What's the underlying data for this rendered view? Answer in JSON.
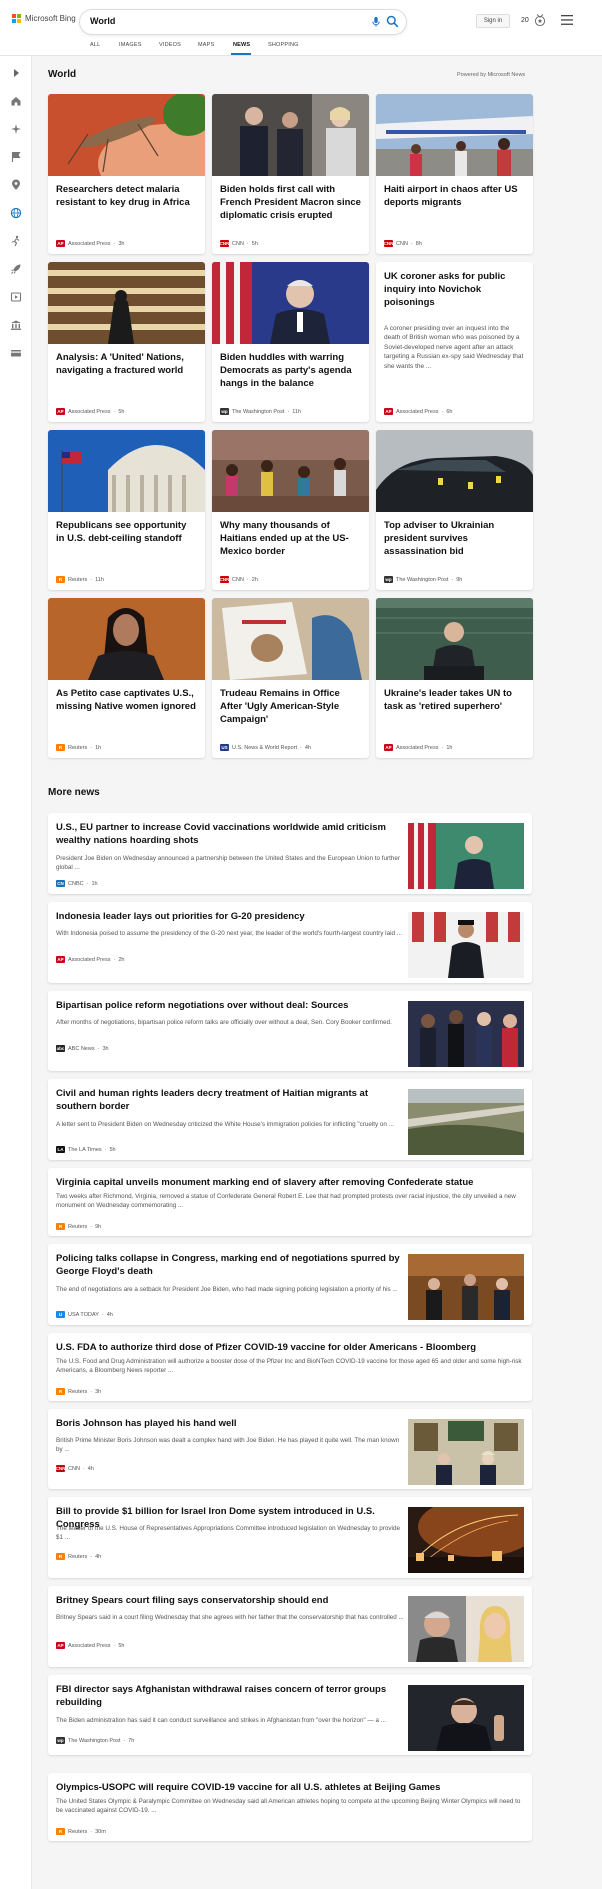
{
  "header": {
    "logo_text": "Microsoft Bing",
    "search_value": "World",
    "signin_label": "Sign in",
    "reward_count": "20"
  },
  "scopes": [
    "ALL",
    "IMAGES",
    "VIDEOS",
    "MAPS",
    "NEWS",
    "SHOPPING"
  ],
  "active_scope": "NEWS",
  "section": {
    "title": "World",
    "powered_by": "Powered by Microsoft News"
  },
  "cards": [
    {
      "title": "Researchers detect malaria resistant to key drug in Africa",
      "source": "Associated Press",
      "time": "3h",
      "logo": "AP"
    },
    {
      "title": "Biden holds first call with French President Macron since diplomatic crisis erupted",
      "source": "CNN",
      "time": "5h",
      "logo": "CNN"
    },
    {
      "title": "Haiti airport in chaos after US deports migrants",
      "source": "CNN",
      "time": "8h",
      "logo": "CNN"
    },
    {
      "title": "Analysis: A 'United' Nations, navigating a fractured world",
      "source": "Associated Press",
      "time": "5h",
      "logo": "AP"
    },
    {
      "title": "Biden huddles with warring Democrats as party's agenda hangs in the balance",
      "source": "The Washington Post",
      "time": "11h",
      "logo": "wp"
    },
    {
      "title": "UK coroner asks for public inquiry into Novichok poisonings",
      "snippet": "A coroner presiding over an inquest into the death of British woman who was poisoned by a Soviet-developed nerve agent after an attack targeting a Russian ex-spy said Wednesday that she wants the ...",
      "source": "Associated Press",
      "time": "6h",
      "logo": "AP"
    },
    {
      "title": "Republicans see opportunity in U.S. debt-ceiling standoff",
      "source": "Reuters",
      "time": "11h",
      "logo": "R"
    },
    {
      "title": "Why many thousands of Haitians ended up at the US-Mexico border",
      "source": "CNN",
      "time": "2h",
      "logo": "CNN"
    },
    {
      "title": "Top adviser to Ukrainian president survives assassination bid",
      "source": "The Washington Post",
      "time": "9h",
      "logo": "wp"
    },
    {
      "title": "As Petito case captivates U.S., missing Native women ignored",
      "source": "Reuters",
      "time": "1h",
      "logo": "R"
    },
    {
      "title": "Trudeau Remains in Office After 'Ugly American-Style Campaign'",
      "source": "U.S. News & World Report",
      "time": "4h",
      "logo": "US"
    },
    {
      "title": "Ukraine's leader takes UN to task as 'retired superhero'",
      "source": "Associated Press",
      "time": "1h",
      "logo": "AP"
    }
  ],
  "more_news": {
    "title": "More news",
    "items": [
      {
        "title": "U.S., EU partner to increase Covid vaccinations worldwide amid criticism wealthy nations hoarding shots",
        "snippet": "President Joe Biden on Wednesday announced a partnership between the United States and the European Union to further global ...",
        "source": "CNBC",
        "time": "1h",
        "logo": "CN"
      },
      {
        "title": "Indonesia leader lays out priorities for G-20 presidency",
        "snippet": "With Indonesia poised to assume the presidency of the G-20 next year, the leader of the world's fourth-largest country laid ...",
        "source": "Associated Press",
        "time": "2h",
        "logo": "AP"
      },
      {
        "title": "Bipartisan police reform negotiations over without deal: Sources",
        "snippet": "After months of negotiations, bipartisan police reform talks are officially over without a deal, Sen. Cory Booker confirmed.",
        "source": "ABC News",
        "time": "3h",
        "logo": "abc"
      },
      {
        "title": "Civil and human rights leaders decry treatment of Haitian migrants at southern border",
        "snippet": "A letter sent to President Biden on Wednesday criticized the White House's immigration policies for inflicting \"cruelty on ...",
        "source": "The LA Times",
        "time": "5h",
        "logo": "LA"
      },
      {
        "title": "Virginia capital unveils monument marking end of slavery after removing Confederate statue",
        "snippet": "Two weeks after Richmond, Virginia, removed a statue of Confederate General Robert E. Lee that had prompted protests over racial injustice, the city unveiled a new monument on Wednesday commemorating ...",
        "source": "Reuters",
        "time": "9h",
        "logo": "R"
      },
      {
        "title": "Policing talks collapse in Congress, marking end of negotiations spurred by George Floyd's death",
        "snippet": "The end of negotiations are a setback for President Joe Biden, who had made signing policing legislation a priority of his ...",
        "source": "USA TODAY",
        "time": "4h",
        "logo": "U"
      },
      {
        "title": "U.S. FDA to authorize third dose of Pfizer COVID-19 vaccine for older Americans - Bloomberg",
        "snippet": "The U.S. Food and Drug Administration will authorize a booster dose of the Pfizer Inc and BioNTech COVID-19 vaccine for those aged 65 and older and some high-risk Americans, a Bloomberg News reporter ...",
        "source": "Reuters",
        "time": "3h",
        "logo": "R"
      },
      {
        "title": "Boris Johnson has played his hand well",
        "snippet": "British Prime Minister Boris Johnson was dealt a complex hand with Joe Biden. He has played it quite well. The man known by ...",
        "source": "CNN",
        "time": "4h",
        "logo": "CNN"
      },
      {
        "title": "Bill to provide $1 billion for Israel Iron Dome system introduced in U.S. Congress",
        "snippet": "The leader of the U.S. House of Representatives Appropriations Committee introduced legislation on Wednesday to provide $1 ...",
        "source": "Reuters",
        "time": "4h",
        "logo": "R"
      },
      {
        "title": "Britney Spears court filing says conservatorship should end",
        "snippet": "Britney Spears said in a court filing Wednesday that she agrees with her father that the conservatorship that has controlled ...",
        "source": "Associated Press",
        "time": "5h",
        "logo": "AP"
      },
      {
        "title": "FBI director says Afghanistan withdrawal raises concern of terror groups rebuilding",
        "snippet": "The Biden administration has said it can conduct surveillance and strikes in Afghanistan from \"over the horizon\" — a ...",
        "source": "The Washington Post",
        "time": "7h",
        "logo": "wp"
      },
      {
        "title": "Olympics-USOPC will require COVID-19 vaccine for all U.S. athletes at Beijing Games",
        "snippet": "The United States Olympic & Paralympic Committee on Wednesday said all American athletes hoping to compete at the upcoming Beijing Winter Olympics will need to be vaccinated against COVID-19. ...",
        "source": "Reuters",
        "time": "30m",
        "logo": "R"
      }
    ]
  },
  "colors": {
    "accent": "#1a73c6",
    "ap": "#d0021b",
    "cnn": "#cc0000",
    "reuters": "#ff8000",
    "wp": "#333333"
  }
}
